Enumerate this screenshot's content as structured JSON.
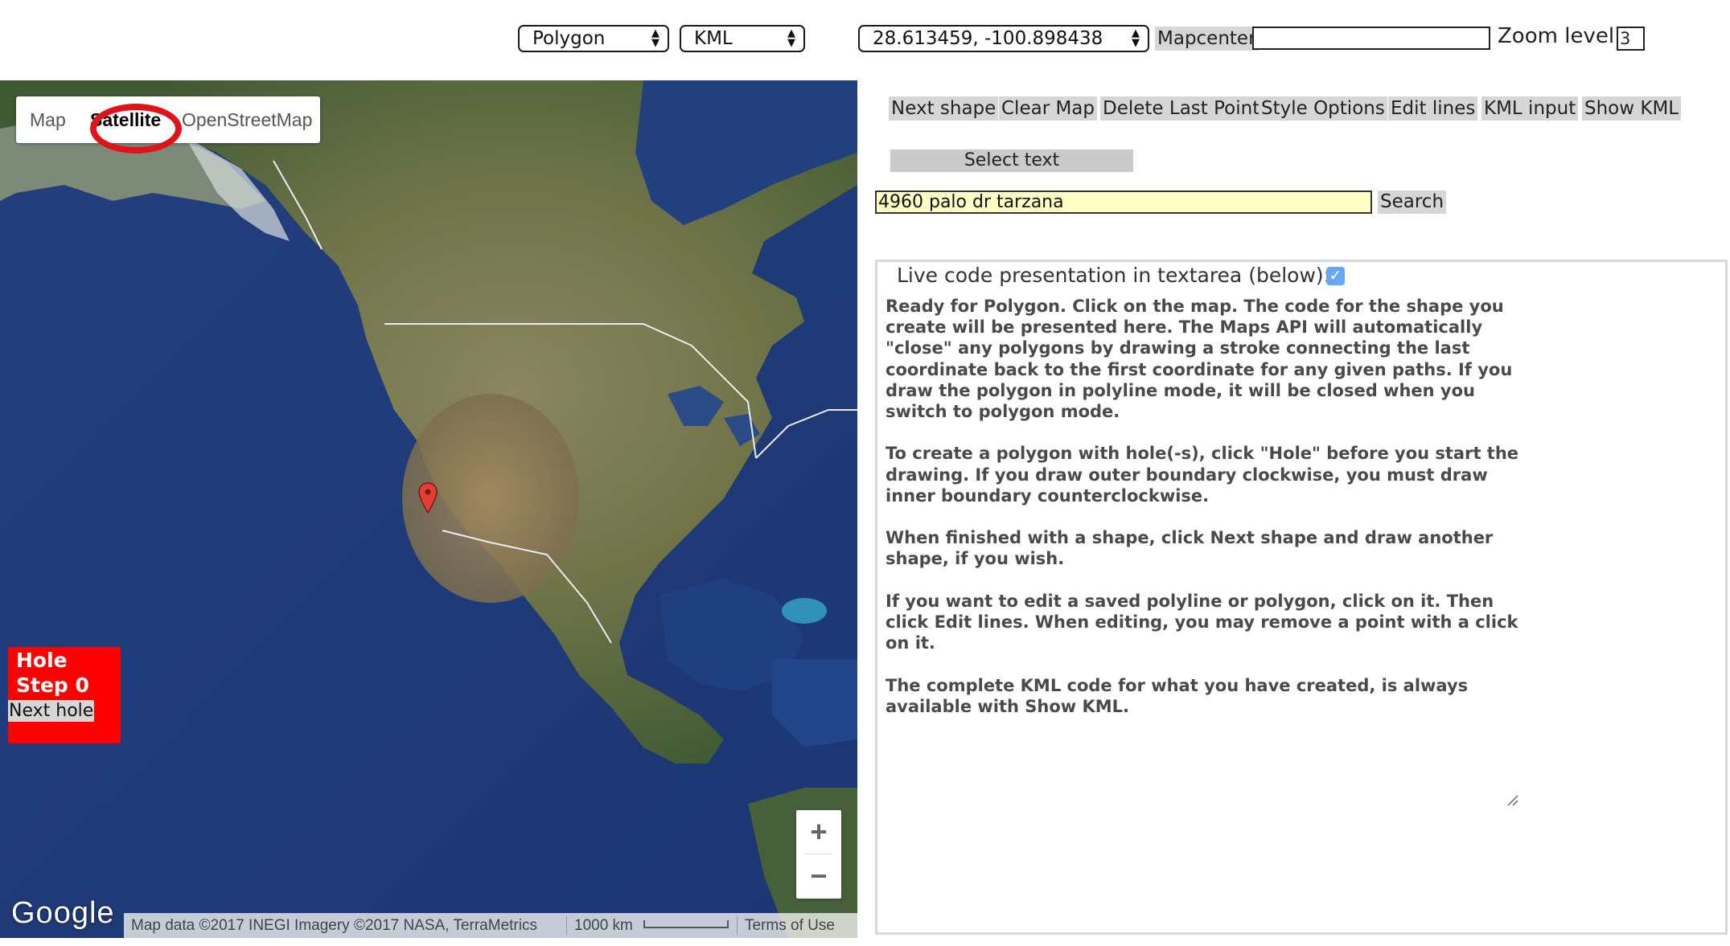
{
  "toolbar": {
    "shape_select": "Polygon",
    "format_select": "KML",
    "coords_select": "28.613459, -100.898438",
    "mapcenter_label": "Mapcenter",
    "mapcenter_value": "",
    "zoom_label": "Zoom level:",
    "zoom_value": "3"
  },
  "map": {
    "map_types": [
      "Map",
      "Satellite",
      "OpenStreetMap"
    ],
    "active_map_type": "Satellite",
    "hole_panel": {
      "title": "Hole",
      "step": "Step 0",
      "next_button": "Next hole"
    },
    "zoom_in": "+",
    "zoom_out": "−",
    "logo": "Google",
    "attribution": "Map data ©2017 INEGI Imagery ©2017 NASA, TerraMetrics",
    "scale": "1000 km",
    "terms": "Terms of Use",
    "marker": "map-marker-icon"
  },
  "actions": {
    "next_shape": "Next shape",
    "clear_map": "Clear Map",
    "delete_last_point": "Delete Last Point",
    "style_options": "Style Options",
    "edit_lines": "Edit lines",
    "kml_input": "KML input",
    "show_kml": "Show KML",
    "select_text": "Select text"
  },
  "search": {
    "value": "4960 palo dr tarzana",
    "button": "Search"
  },
  "code_panel": {
    "header": "Live code presentation in textarea (below):",
    "checked": true,
    "paragraphs": [
      "Ready for Polygon. Click on the map. The code for the shape you create will be presented here. The Maps API will automatically \"close\" any polygons by drawing a stroke connecting the last coordinate back to the first coordinate for any given paths. If you draw the polygon in polyline mode, it will be closed when you switch to polygon mode.",
      "To create a polygon with hole(-s), click \"Hole\" before you start the drawing. If you draw outer boundary clockwise, you must draw inner boundary counterclockwise.",
      "When finished with a shape, click Next shape and draw another shape, if you wish.",
      "If you want to edit a saved polyline or polygon, click on it. Then click Edit lines. When editing, you may remove a point with a click on it.",
      "The complete KML code for what you have created, is always available with Show KML."
    ]
  },
  "colors": {
    "highlight_ring": "#e1131a",
    "hole_panel": "#ff0000",
    "search_field": "#ffffc4",
    "checkbox": "#64a9f5"
  }
}
